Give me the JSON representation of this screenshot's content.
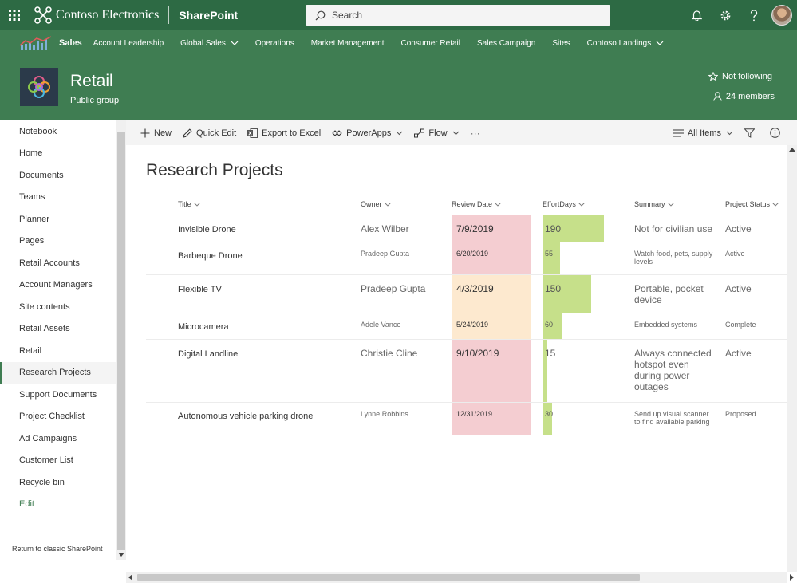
{
  "suite": {
    "brand": "Contoso Electronics",
    "app": "SharePoint",
    "search_placeholder": "Search"
  },
  "hub": {
    "title": "Sales",
    "items": [
      {
        "label": "Account Leadership",
        "dropdown": false
      },
      {
        "label": "Global Sales",
        "dropdown": true
      },
      {
        "label": "Operations",
        "dropdown": false
      },
      {
        "label": "Market Management",
        "dropdown": false
      },
      {
        "label": "Consumer Retail",
        "dropdown": false
      },
      {
        "label": "Sales Campaign",
        "dropdown": false
      },
      {
        "label": "Sites",
        "dropdown": false
      },
      {
        "label": "Contoso Landings",
        "dropdown": true
      }
    ]
  },
  "site": {
    "title": "Retail",
    "subtitle": "Public group",
    "follow": "Not following",
    "members": "24 members"
  },
  "leftnav": {
    "items": [
      "Notebook",
      "Home",
      "Documents",
      "Teams",
      "Planner",
      "Pages",
      "Retail Accounts",
      "Account Managers",
      "Site contents",
      "Retail Assets",
      "Retail",
      "Research Projects",
      "Support Documents",
      "Project Checklist",
      "Ad Campaigns",
      "Customer List",
      "Recycle bin"
    ],
    "selected": "Research Projects",
    "edit": "Edit",
    "classic": "Return to classic SharePoint"
  },
  "cmdbar": {
    "new": "New",
    "quick_edit": "Quick Edit",
    "export": "Export to Excel",
    "powerapps": "PowerApps",
    "flow": "Flow",
    "more": "···",
    "view": "All Items"
  },
  "list": {
    "title": "Research Projects",
    "columns": [
      "Title",
      "Owner",
      "Review Date",
      "EffortDays",
      "Summary",
      "Project Status"
    ],
    "effort_max": 280,
    "rows": [
      {
        "title": "Invisible Drone",
        "owner": "Alex Wilber",
        "date": "7/9/2019",
        "date_flag": "red",
        "effort": "190",
        "summary": "Not for civilian use",
        "status": "Active",
        "size": "big"
      },
      {
        "title": "Barbeque Drone",
        "owner": "Pradeep Gupta",
        "date": "6/20/2019",
        "date_flag": "red",
        "effort": "55",
        "summary": "Watch food, pets, supply levels",
        "status": "Active",
        "size": "small"
      },
      {
        "title": "Flexible TV",
        "owner": "Pradeep Gupta",
        "date": "4/3/2019",
        "date_flag": "orange",
        "effort": "150",
        "summary": "Portable, pocket device",
        "status": "Active",
        "size": "big"
      },
      {
        "title": "Microcamera",
        "owner": "Adele Vance",
        "date": "5/24/2019",
        "date_flag": "orange",
        "effort": "60",
        "summary": "Embedded systems",
        "status": "Complete",
        "size": "small"
      },
      {
        "title": "Digital Landline",
        "owner": "Christie Cline",
        "date": "9/10/2019",
        "date_flag": "red",
        "effort": "15",
        "summary": "Always connected hotspot even during power outages",
        "status": "Active",
        "size": "big"
      },
      {
        "title": "Autonomous vehicle parking drone",
        "owner": "Lynne Robbins",
        "date": "12/31/2019",
        "date_flag": "red",
        "effort": "30",
        "summary": "Send up visual scanner to find available parking",
        "status": "Proposed",
        "size": "small"
      }
    ]
  }
}
